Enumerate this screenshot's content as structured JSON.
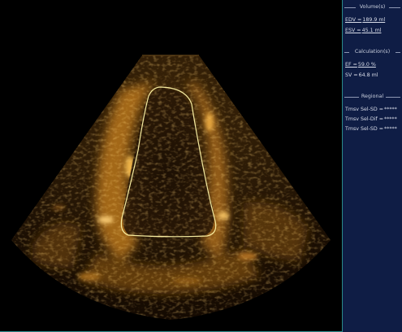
{
  "panel": {
    "volume_title": "Volume(s)",
    "edv_label": "EDV =",
    "edv_value": "189.9 ml",
    "esv_label": "ESV =",
    "esv_value": "45.1 ml",
    "calc_title": "Calculation(s)",
    "ef_label": "EF =",
    "ef_value": "59.0 %",
    "sv_label": "SV =",
    "sv_value": "64.8 ml",
    "regional_title": "Regional",
    "tmsv_sd_label": "Tmsv Sel-SD =",
    "tmsv_sd_value": "*****",
    "tmsv_dif_label": "Tmsv Sel-Dif =",
    "tmsv_dif_value": "*****",
    "tmsv_sd2_label": "Tmsv Sel-SD =",
    "tmsv_sd2_value": "*****"
  },
  "colors": {
    "panel_bg": "#0f1d45",
    "frame_border": "#2a8a8a",
    "contour": "#fff6a8",
    "tissue": "#f0b040"
  }
}
